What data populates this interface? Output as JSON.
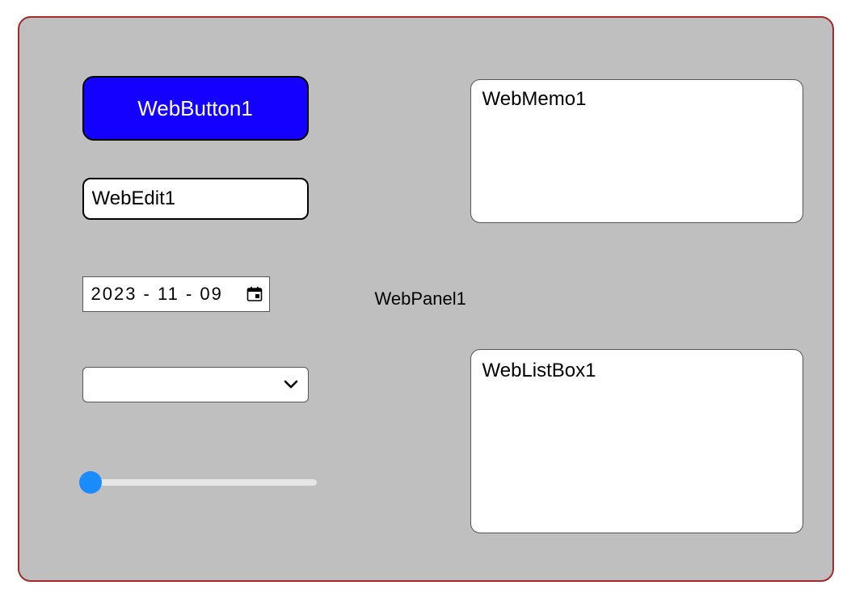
{
  "panel": {
    "caption": "WebPanel1",
    "colors": {
      "background": "#bfbfbf",
      "border": "#a52a2a"
    }
  },
  "button1": {
    "label": "WebButton1",
    "color": "#1400ff"
  },
  "edit1": {
    "value": "WebEdit1"
  },
  "date1": {
    "value": "2023 - 11 - 09"
  },
  "combo1": {
    "selected": ""
  },
  "slider1": {
    "value": 0,
    "min": 0,
    "max": 100
  },
  "memo1": {
    "value": "WebMemo1"
  },
  "listbox1": {
    "items": [
      "WebListBox1"
    ]
  }
}
